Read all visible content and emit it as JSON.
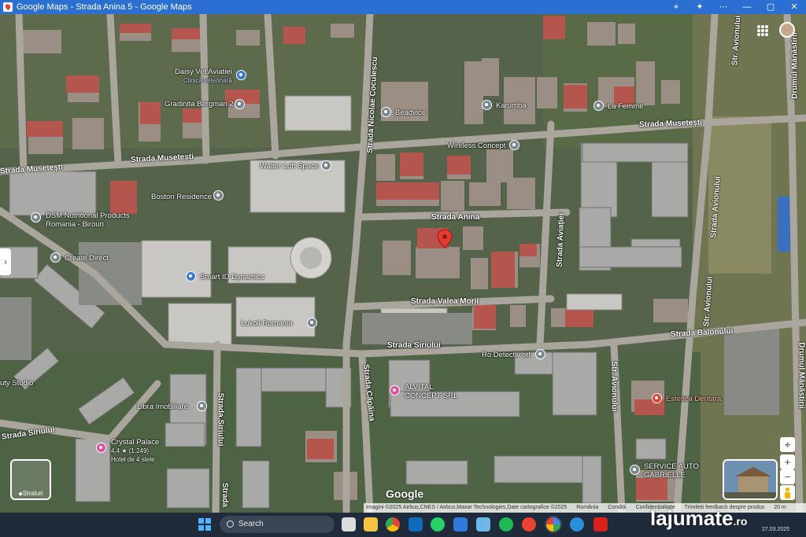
{
  "window": {
    "title": "Google Maps - Strada Anina 5 - Google Maps"
  },
  "streets": {
    "musetesti_w": "Strada Musetești",
    "musetesti_c": "Strada Musetești",
    "musetesti_e": "Strada Musetești",
    "nicolae_coculescu": "Strada Nicolae Coculescu",
    "anina": "Strada Anina",
    "aviatiei": "Strada Aviației",
    "avionului_n": "Str. Avionului",
    "avionului_top": "Str. Avionului",
    "avionului_s": "Str. Avionului",
    "avionului_ne": "Strada Avionului",
    "manastirii_n": "Drumul Mănăstirii",
    "manastirii_s": "Drumul Mănăstirii",
    "valea_morii": "Strada Valea Morii",
    "balonului": "Strada Balonului",
    "siriului_c": "Strada Siriului",
    "siriului_w": "Strada Siriului",
    "siriului_v": "Strada Siriului",
    "siriului_sv": "Strada",
    "capaina": "Strada Căpăina"
  },
  "places": [
    {
      "id": "daisy",
      "name": "Daisy Vet Aviatiei",
      "sub": "Clinică veterinară"
    },
    {
      "id": "bergman",
      "name": "Gradinita Bergman 2",
      "sub": ""
    },
    {
      "id": "beadvice",
      "name": "Beadvice",
      "sub": ""
    },
    {
      "id": "karumba",
      "name": "Karumba",
      "sub": ""
    },
    {
      "id": "lafemme",
      "name": "La Femme",
      "sub": ""
    },
    {
      "id": "wireless",
      "name": "Wireless Concept",
      "sub": ""
    },
    {
      "id": "walter",
      "name": "Walter Loft Space",
      "sub": ""
    },
    {
      "id": "boston",
      "name": "Boston Residence",
      "sub": ""
    },
    {
      "id": "dsm",
      "name": "DSM Nutritional Products",
      "sub": "Romania - Birouri"
    },
    {
      "id": "create",
      "name": "Create Direct",
      "sub": ""
    },
    {
      "id": "smartid",
      "name": "Smart ID Dynamics",
      "sub": ""
    },
    {
      "id": "lukoil",
      "name": "Lukoil Romania",
      "sub": ""
    },
    {
      "id": "rodetectiv",
      "name": "Ro Detectiv srl",
      "sub": ""
    },
    {
      "id": "alvital",
      "name": "ALVITAL",
      "sub": "CONCEPT SRL"
    },
    {
      "id": "libra",
      "name": "Libra Imobiliare",
      "sub": ""
    },
    {
      "id": "beauty",
      "name": "uty Studio",
      "sub": ""
    },
    {
      "id": "crystal",
      "name": "Crystal Palace",
      "sub": "4,4 ★ (1.249)"
    },
    {
      "id": "crystal_sub",
      "name": "Hotel de 4 stele",
      "sub": ""
    },
    {
      "id": "estetica",
      "name": "Estetica Dentara",
      "sub": ""
    },
    {
      "id": "service",
      "name": "SERVICE AUTO",
      "sub": "GABRIELLE"
    }
  ],
  "controls": {
    "layers_label": "Straturi",
    "zoom_in": "+",
    "zoom_out": "−",
    "side_toggle": "›",
    "google": "Google"
  },
  "attribution": {
    "imagery": "Imagini ©2025 Airbus,CNES / Airbus,Maxar Technologies,Date cartografice ©2025",
    "country": "România",
    "terms": "Condiții",
    "privacy": "Confidențialitate",
    "feedback": "Trimiteți feedback despre produs",
    "scale": "20 m"
  },
  "taskbar": {
    "search": "Search",
    "date": "27.03.2025"
  },
  "watermark": {
    "brand": "lajumate",
    "tld": ".ro"
  }
}
